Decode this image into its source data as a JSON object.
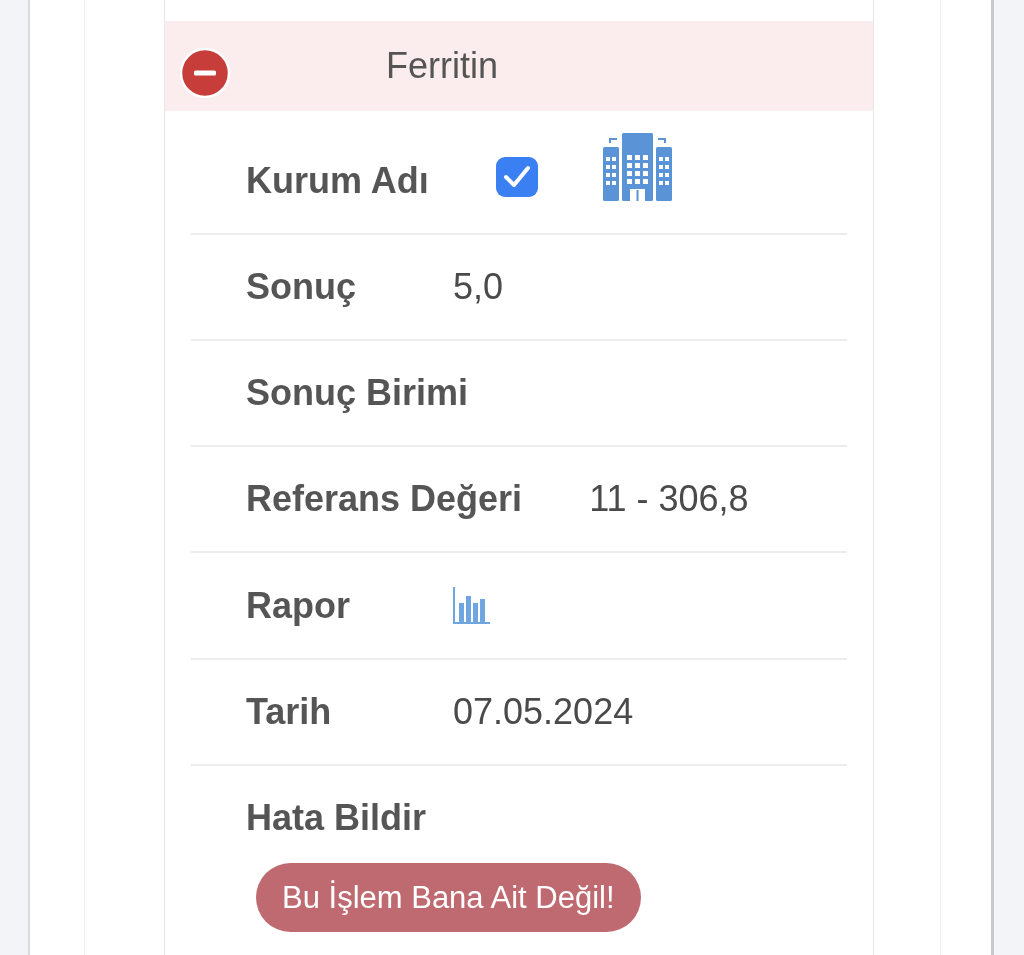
{
  "test": {
    "name": "Ferritin",
    "expanded": true
  },
  "fields": [
    {
      "kind": "institution",
      "label": "Kurum Adı",
      "checked": true
    },
    {
      "kind": "text",
      "label": "Sonuç",
      "value": "5,0"
    },
    {
      "kind": "text",
      "label": "Sonuç Birimi"
    },
    {
      "kind": "text",
      "label": "Referans Değeri",
      "value": "11 - 306,8"
    },
    {
      "kind": "report",
      "label": "Rapor"
    },
    {
      "kind": "text",
      "label": "Tarih",
      "value": "07.05.2024"
    }
  ],
  "error_report": {
    "label": "Hata Bildir",
    "button": "Bu İşlem Bana Ait Değil!"
  }
}
